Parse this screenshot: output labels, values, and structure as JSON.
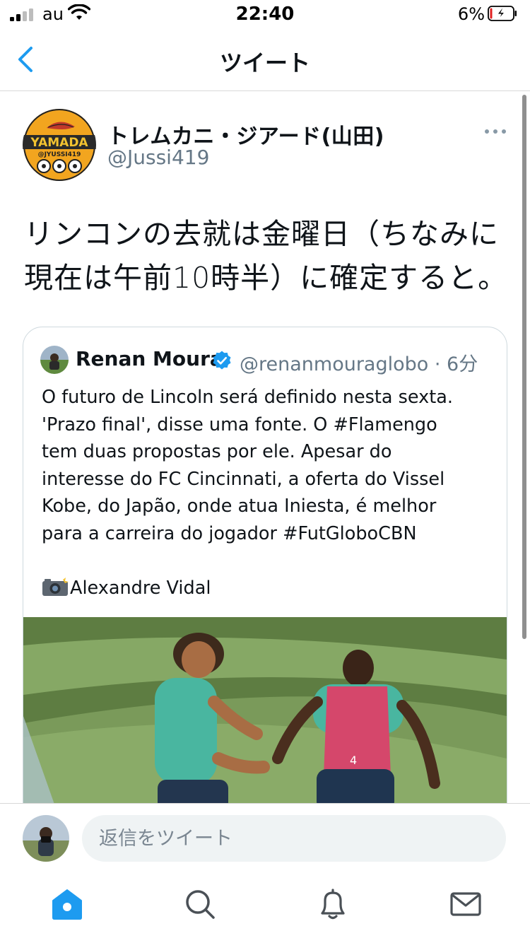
{
  "status_bar": {
    "carrier": "au",
    "time": "22:40",
    "battery": "6%"
  },
  "nav": {
    "title": "ツイート"
  },
  "tweet": {
    "display_name": "トレムカニ・ジアード(山田)",
    "handle": "@Jussi419",
    "text_line1": "リンコンの去就は金曜日（ちなみに",
    "text_line2": "現在は午前10時半）に確定すると。",
    "avatar_badge": "YAMADA",
    "avatar_sub": "@JYUSSI419"
  },
  "quoted": {
    "name": "Renan Moura",
    "handle_time": "@renanmouraglobo · 6分",
    "lines": [
      "O futuro de Lincoln será definido nesta sexta.",
      "'Prazo final', disse uma fonte. O #Flamengo",
      "tem duas propostas por ele. Apesar do",
      "interesse do FC Cincinnati, a oferta do Vissel",
      "Kobe, do Japão, onde atua Iniesta, é melhor",
      "para a carreira do jogador #FutGloboCBN"
    ],
    "credit": "Alexandre Vidal",
    "jersey_text": "4"
  },
  "reply": {
    "placeholder": "返信をツイート"
  },
  "colors": {
    "accent": "#1d9bf0",
    "muted": "#657786",
    "icon": "#4a5056"
  },
  "icons": [
    "signal-icon",
    "wifi-icon",
    "battery-icon",
    "back-chevron-icon",
    "more-icon",
    "verified-icon",
    "camera-flash-icon",
    "home-icon",
    "search-icon",
    "notifications-icon",
    "messages-icon"
  ]
}
